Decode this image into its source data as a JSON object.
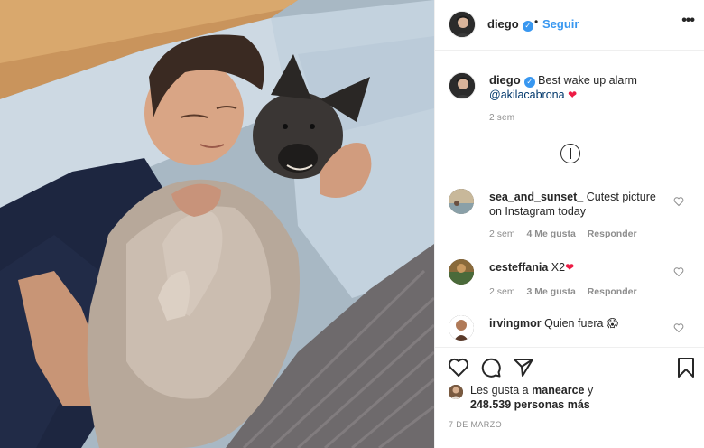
{
  "post": {
    "image_alt_subject": "man sleeping with dog in bed",
    "header": {
      "username": "diego",
      "dot": "•",
      "follow_label": "Seguir",
      "more_label": "•••"
    },
    "caption": {
      "username": "diego",
      "text": "Best wake up alarm",
      "mention": "@akilacabrona",
      "emoji": "❤",
      "time": "2 sem"
    },
    "comments": [
      {
        "username": "sea_and_sunset_",
        "text": "Cutest picture on Instagram today",
        "time": "2 sem",
        "likes": "4 Me gusta",
        "reply": "Responder"
      },
      {
        "username": "cesteffania",
        "text": "X2",
        "emoji": "❤",
        "time": "2 sem",
        "likes": "3 Me gusta",
        "reply": "Responder"
      },
      {
        "username": "irvingmor",
        "text": "Quien fuera",
        "emoji": "😱"
      }
    ],
    "likes": {
      "prefix": "Les gusta a",
      "user": "manearce",
      "connector": "y",
      "count": "248.539 personas más"
    },
    "date": "7 DE MARZO"
  },
  "colors": {
    "link": "#3897f0",
    "mention": "#00376b",
    "heart": "#ed1c45",
    "muted": "#8e8e8e"
  },
  "icons": [
    "verified-badge-icon",
    "more-options-icon",
    "load-more-icon",
    "comment-like-heart-icon",
    "like-heart-icon",
    "comment-bubble-icon",
    "share-plane-icon",
    "bookmark-icon"
  ]
}
